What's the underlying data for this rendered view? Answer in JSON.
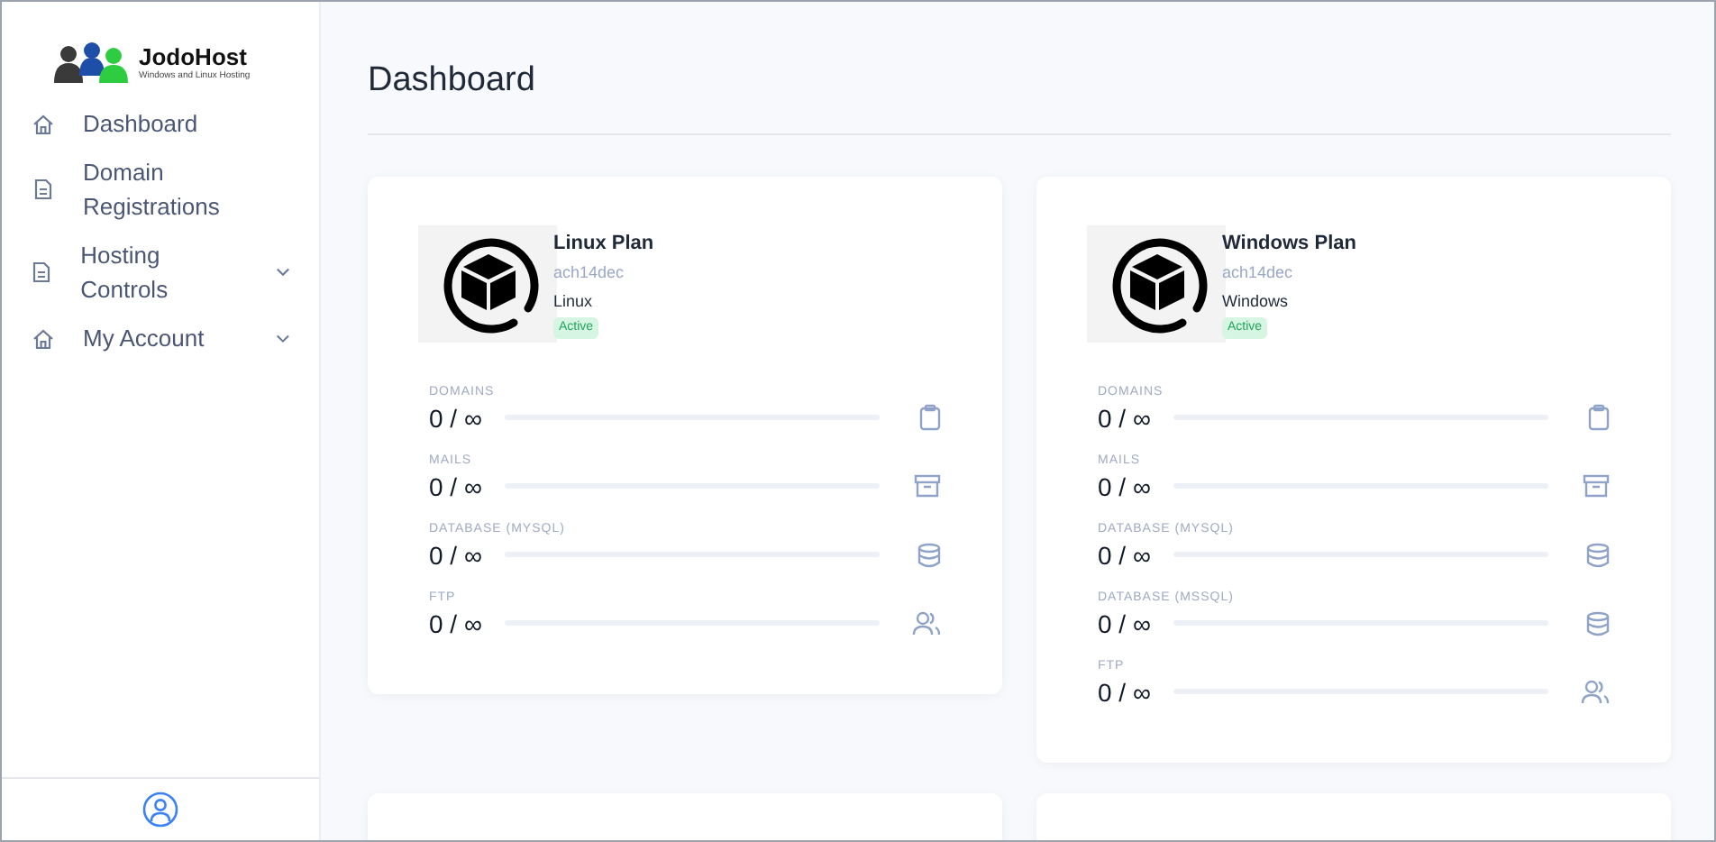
{
  "logo": {
    "name": "JodoHost",
    "tagline": "Windows and Linux Hosting"
  },
  "sidebar": {
    "items": [
      {
        "label": "Dashboard",
        "kind": "home",
        "expandable": false
      },
      {
        "label": "Domain Registrations",
        "kind": "document",
        "expandable": false
      },
      {
        "label": "Hosting Controls",
        "kind": "document",
        "expandable": true
      },
      {
        "label": "My Account",
        "kind": "home",
        "expandable": true
      }
    ]
  },
  "page_title": "Dashboard",
  "plans": [
    {
      "name": "Linux Plan",
      "username": "ach14dec",
      "os": "Linux",
      "status": "Active",
      "metrics": [
        {
          "label": "DOMAINS",
          "value": "0 / ∞",
          "kind": "clipboard"
        },
        {
          "label": "MAILS",
          "value": "0 / ∞",
          "kind": "archive"
        },
        {
          "label": "DATABASE (MYSQL)",
          "value": "0 / ∞",
          "kind": "database"
        },
        {
          "label": "FTP",
          "value": "0 / ∞",
          "kind": "users"
        }
      ]
    },
    {
      "name": "Windows Plan",
      "username": "ach14dec",
      "os": "Windows",
      "status": "Active",
      "metrics": [
        {
          "label": "DOMAINS",
          "value": "0 / ∞",
          "kind": "clipboard"
        },
        {
          "label": "MAILS",
          "value": "0 / ∞",
          "kind": "archive"
        },
        {
          "label": "DATABASE (MYSQL)",
          "value": "0 / ∞",
          "kind": "database"
        },
        {
          "label": "DATABASE (MSSQL)",
          "value": "0 / ∞",
          "kind": "database"
        },
        {
          "label": "FTP",
          "value": "0 / ∞",
          "kind": "users"
        }
      ]
    }
  ]
}
